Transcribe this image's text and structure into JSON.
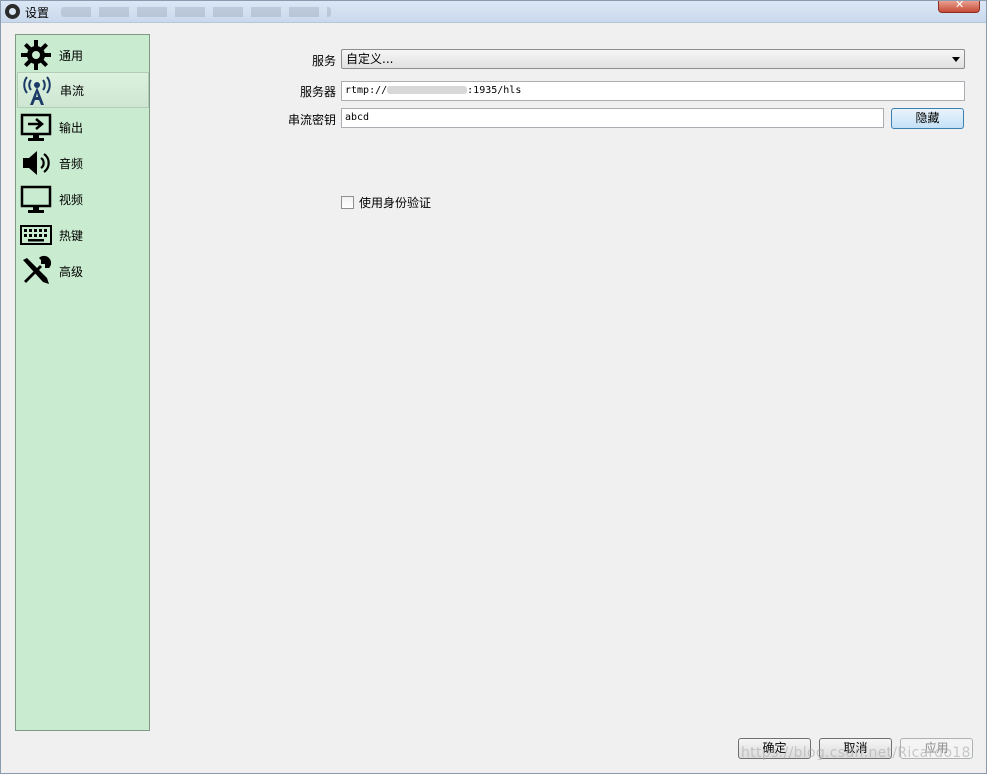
{
  "window": {
    "title": "设置"
  },
  "sidebar": {
    "items": [
      {
        "label": "通用",
        "icon": "gear-icon"
      },
      {
        "label": "串流",
        "icon": "broadcast-tower-icon",
        "active": true
      },
      {
        "label": "输出",
        "icon": "output-monitor-icon"
      },
      {
        "label": "音频",
        "icon": "speaker-icon"
      },
      {
        "label": "视频",
        "icon": "monitor-icon"
      },
      {
        "label": "热键",
        "icon": "keyboard-icon"
      },
      {
        "label": "高级",
        "icon": "tools-icon"
      }
    ]
  },
  "stream": {
    "service_label": "服务",
    "service_value": "自定义...",
    "server_label": "服务器",
    "server_value_prefix": "rtmp://",
    "server_value_suffix": ":1935/hls",
    "key_label": "串流密钥",
    "key_value": "abcd",
    "hide_button": "隐藏",
    "auth_checkbox_label": "使用身份验证",
    "auth_checked": false
  },
  "footer": {
    "ok": "确定",
    "cancel": "取消",
    "apply": "应用"
  },
  "watermark": "https://blog.csdn.net/Ricardo18",
  "colors": {
    "sidebar_bg": "#c9ebcf",
    "window_bg": "#f0f0f0",
    "primary_button_border": "#3c7fb1"
  }
}
